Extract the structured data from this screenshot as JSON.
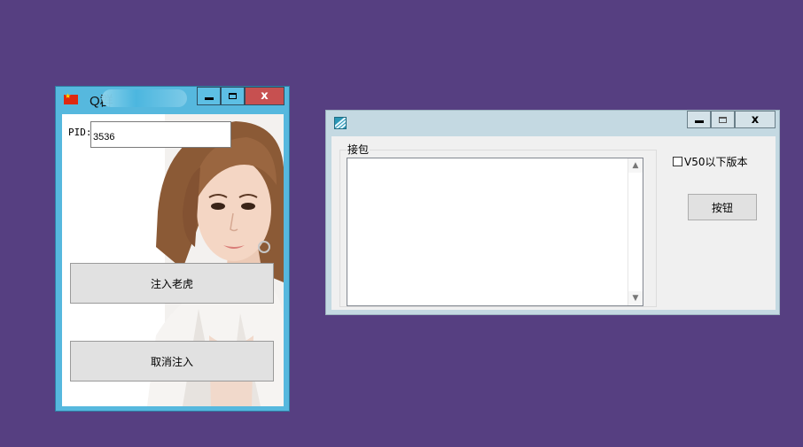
{
  "injector_window": {
    "title": "Q群",
    "controls": {
      "minimize": "",
      "maximize": "",
      "close": "x"
    },
    "pid_label": "PID:",
    "pid_value": "3536",
    "inject_button": "注入老虎",
    "cancel_button": "取消注入",
    "icon": "china-flag-icon"
  },
  "packet_window": {
    "title": "",
    "icon": "app-logo-icon",
    "controls": {
      "minimize": "",
      "maximize": "",
      "close": "x"
    },
    "group_label": "接包",
    "textarea_value": "",
    "checkbox_label": "V50以下版本",
    "checkbox_checked": false,
    "action_button": "按钮"
  },
  "colors": {
    "desktop": "#563f81",
    "injector_frame": "#56b8de",
    "close_button": "#c75050",
    "packet_frame": "#c4d9e2"
  }
}
